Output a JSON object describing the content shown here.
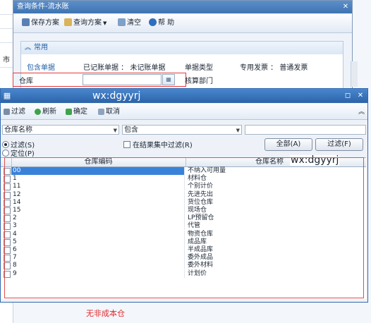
{
  "background": {
    "left_char": "市"
  },
  "query_window": {
    "title": "查询条件-流水账",
    "toolbar": {
      "save_scheme": "保存方案",
      "query_scheme": "查询方案",
      "clear": "清空",
      "help": "帮 助"
    },
    "section": "常用",
    "fields": {
      "include_docs": "包含单据",
      "posted_docs": "已记账单据 ： 未记账单据",
      "doc_type": "单据类型",
      "special_invoice": "专用发票 ： 普通发票",
      "warehouse": "仓库",
      "account_dept": "核算部门"
    }
  },
  "dialog": {
    "title_text": "wx:dgyyrj",
    "toolbar": {
      "filter": "过滤",
      "refresh": "刷新",
      "ok": "确定",
      "cancel": "取消"
    },
    "filter": {
      "field_select": "仓库名称",
      "op_select": "包含",
      "value": ""
    },
    "options": {
      "filter_radio": "过滤(S)",
      "locate_radio": "定位(P)",
      "in_result_filter": "在结果集中过滤(R)"
    },
    "buttons": {
      "all": "全部(A)",
      "filter": "过滤(F)"
    },
    "columns": {
      "code": "仓库编码",
      "name": "仓库名称"
    },
    "header_watermark": "wx:dgyyrj",
    "rows": [
      {
        "code": "00",
        "name": "不纳入可用量"
      },
      {
        "code": "1",
        "name": "材料仓"
      },
      {
        "code": "11",
        "name": "个别计价"
      },
      {
        "code": "12",
        "name": "先进先出"
      },
      {
        "code": "14",
        "name": "货位仓库"
      },
      {
        "code": "15",
        "name": "现场仓"
      },
      {
        "code": "2",
        "name": "LP预留仓"
      },
      {
        "code": "3",
        "name": "代管"
      },
      {
        "code": "4",
        "name": "物资仓库"
      },
      {
        "code": "5",
        "name": "成品库"
      },
      {
        "code": "6",
        "name": "半成品库"
      },
      {
        "code": "7",
        "name": "委外成品"
      },
      {
        "code": "8",
        "name": "委外材料"
      },
      {
        "code": "9",
        "name": "计划价"
      }
    ]
  },
  "annotation": "无非成本仓",
  "colors": {
    "accent": "#3a82d9",
    "highlight_border": "#e25050",
    "title_bar": "#2b63a8"
  }
}
